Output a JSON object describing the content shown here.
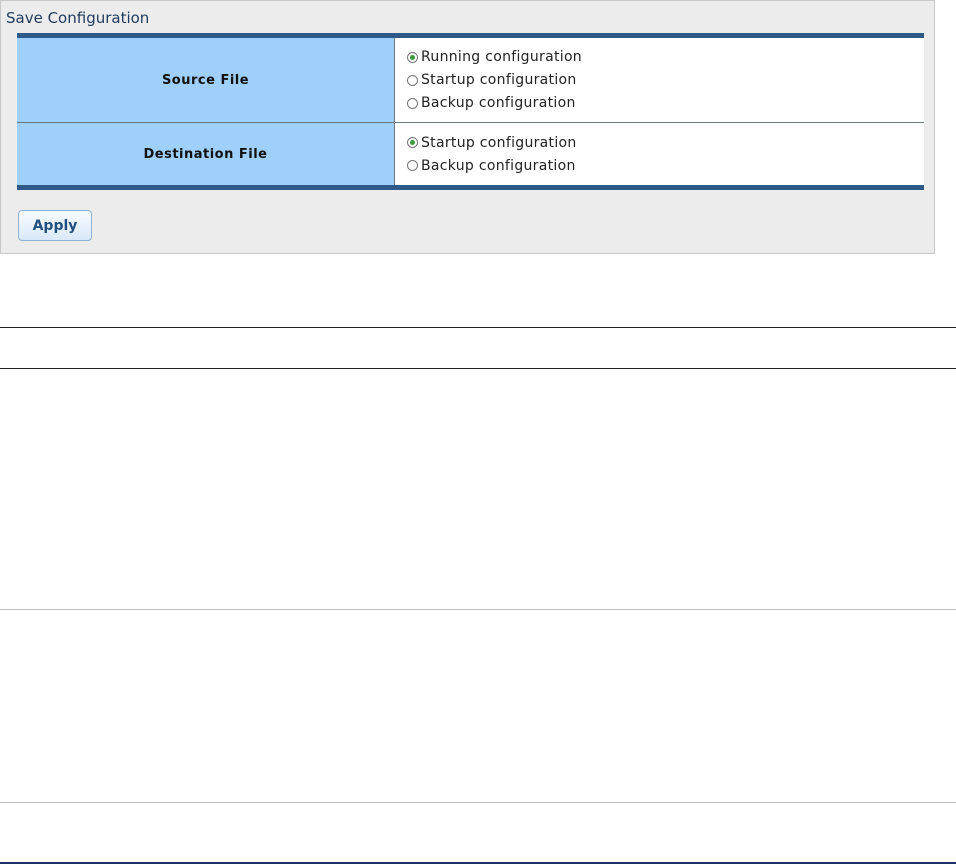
{
  "panel": {
    "title": "Save Configuration"
  },
  "source_file": {
    "label": "Source File",
    "options": [
      {
        "label": "Running configuration",
        "selected": true
      },
      {
        "label": "Startup configuration",
        "selected": false
      },
      {
        "label": "Backup configuration",
        "selected": false
      }
    ]
  },
  "destination_file": {
    "label": "Destination File",
    "options": [
      {
        "label": "Startup configuration",
        "selected": true
      },
      {
        "label": "Backup configuration",
        "selected": false
      }
    ]
  },
  "actions": {
    "apply_label": "Apply"
  }
}
